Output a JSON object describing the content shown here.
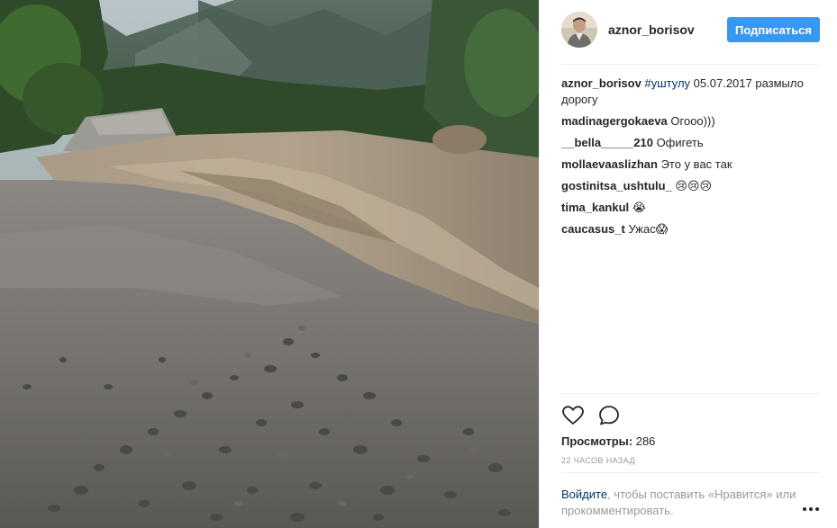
{
  "post": {
    "username": "aznor_borisov",
    "follow_label": "Подписаться",
    "caption": {
      "username": "aznor_borisov",
      "hashtag": "#уштулу",
      "text": "05.07.2017 размыло дорогу"
    },
    "comments": [
      {
        "user": "madinagergokaeva",
        "text": "Огооо)))"
      },
      {
        "user": "__bella_____210",
        "text": "Офигеть"
      },
      {
        "user": "mollaevaaslizhan",
        "text": "Это у вас так"
      },
      {
        "user": "gostinitsa_ushtulu_",
        "text": "😢😢😢"
      },
      {
        "user": "tima_kankul",
        "text": "😭"
      },
      {
        "user": "caucasus_t",
        "text": "Ужас😱"
      }
    ],
    "views_label": "Просмотры:",
    "views_count": "286",
    "time_ago": "22 часов назад",
    "login_link": "Войдите",
    "login_text": ", чтобы поставить «Нравится» или прокомментировать."
  },
  "icons": {
    "like": "heart-outline-icon",
    "comment": "speech-bubble-icon",
    "more": "more-dots-icon"
  },
  "colors": {
    "accent": "#3897f0",
    "link": "#003569",
    "muted": "#999999",
    "text": "#262626"
  }
}
